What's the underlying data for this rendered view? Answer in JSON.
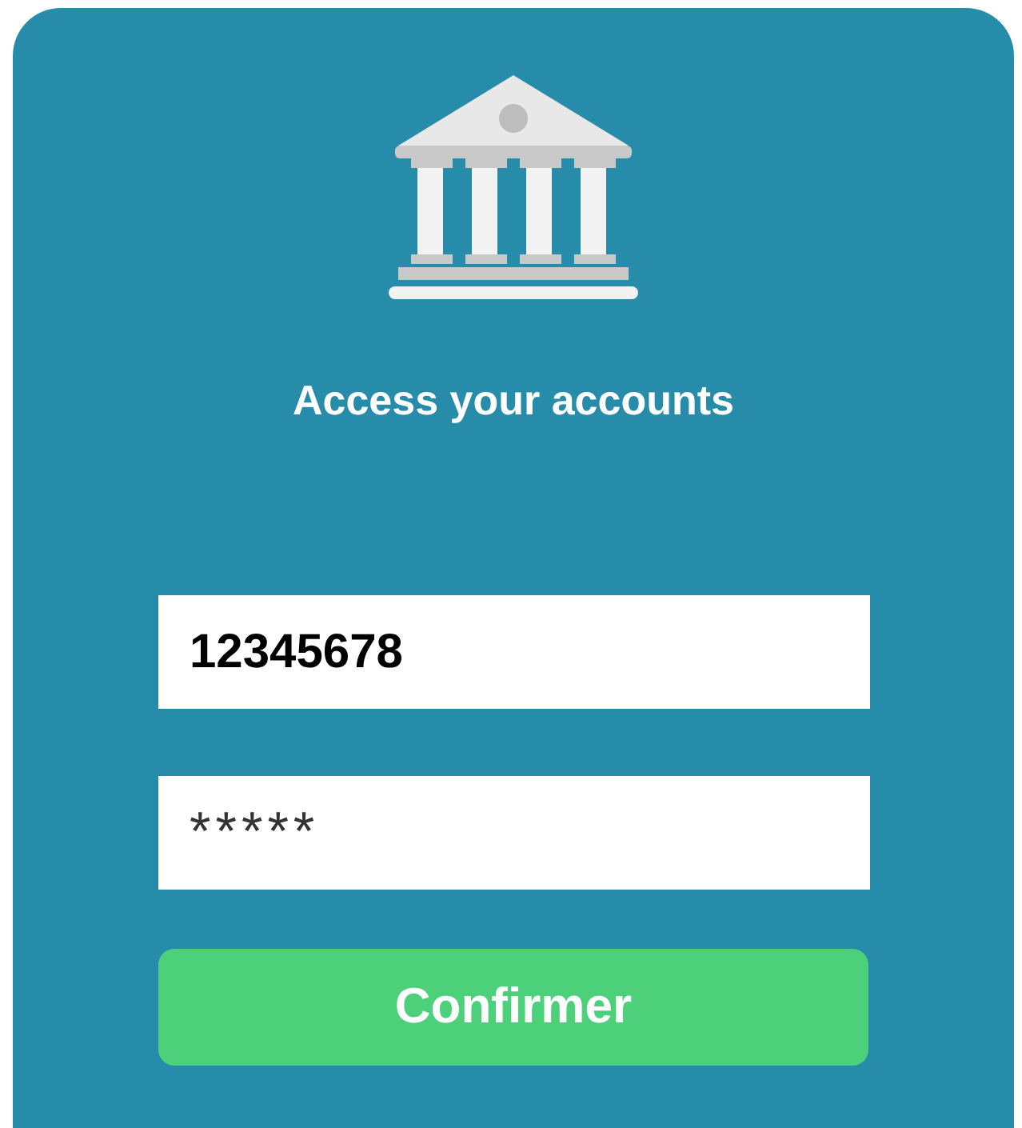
{
  "title": "Access your accounts",
  "fields": [
    {
      "value": "12345678",
      "kind": "text"
    },
    {
      "value": "*****",
      "kind": "masked"
    }
  ],
  "button": {
    "label": "Confirmer"
  }
}
